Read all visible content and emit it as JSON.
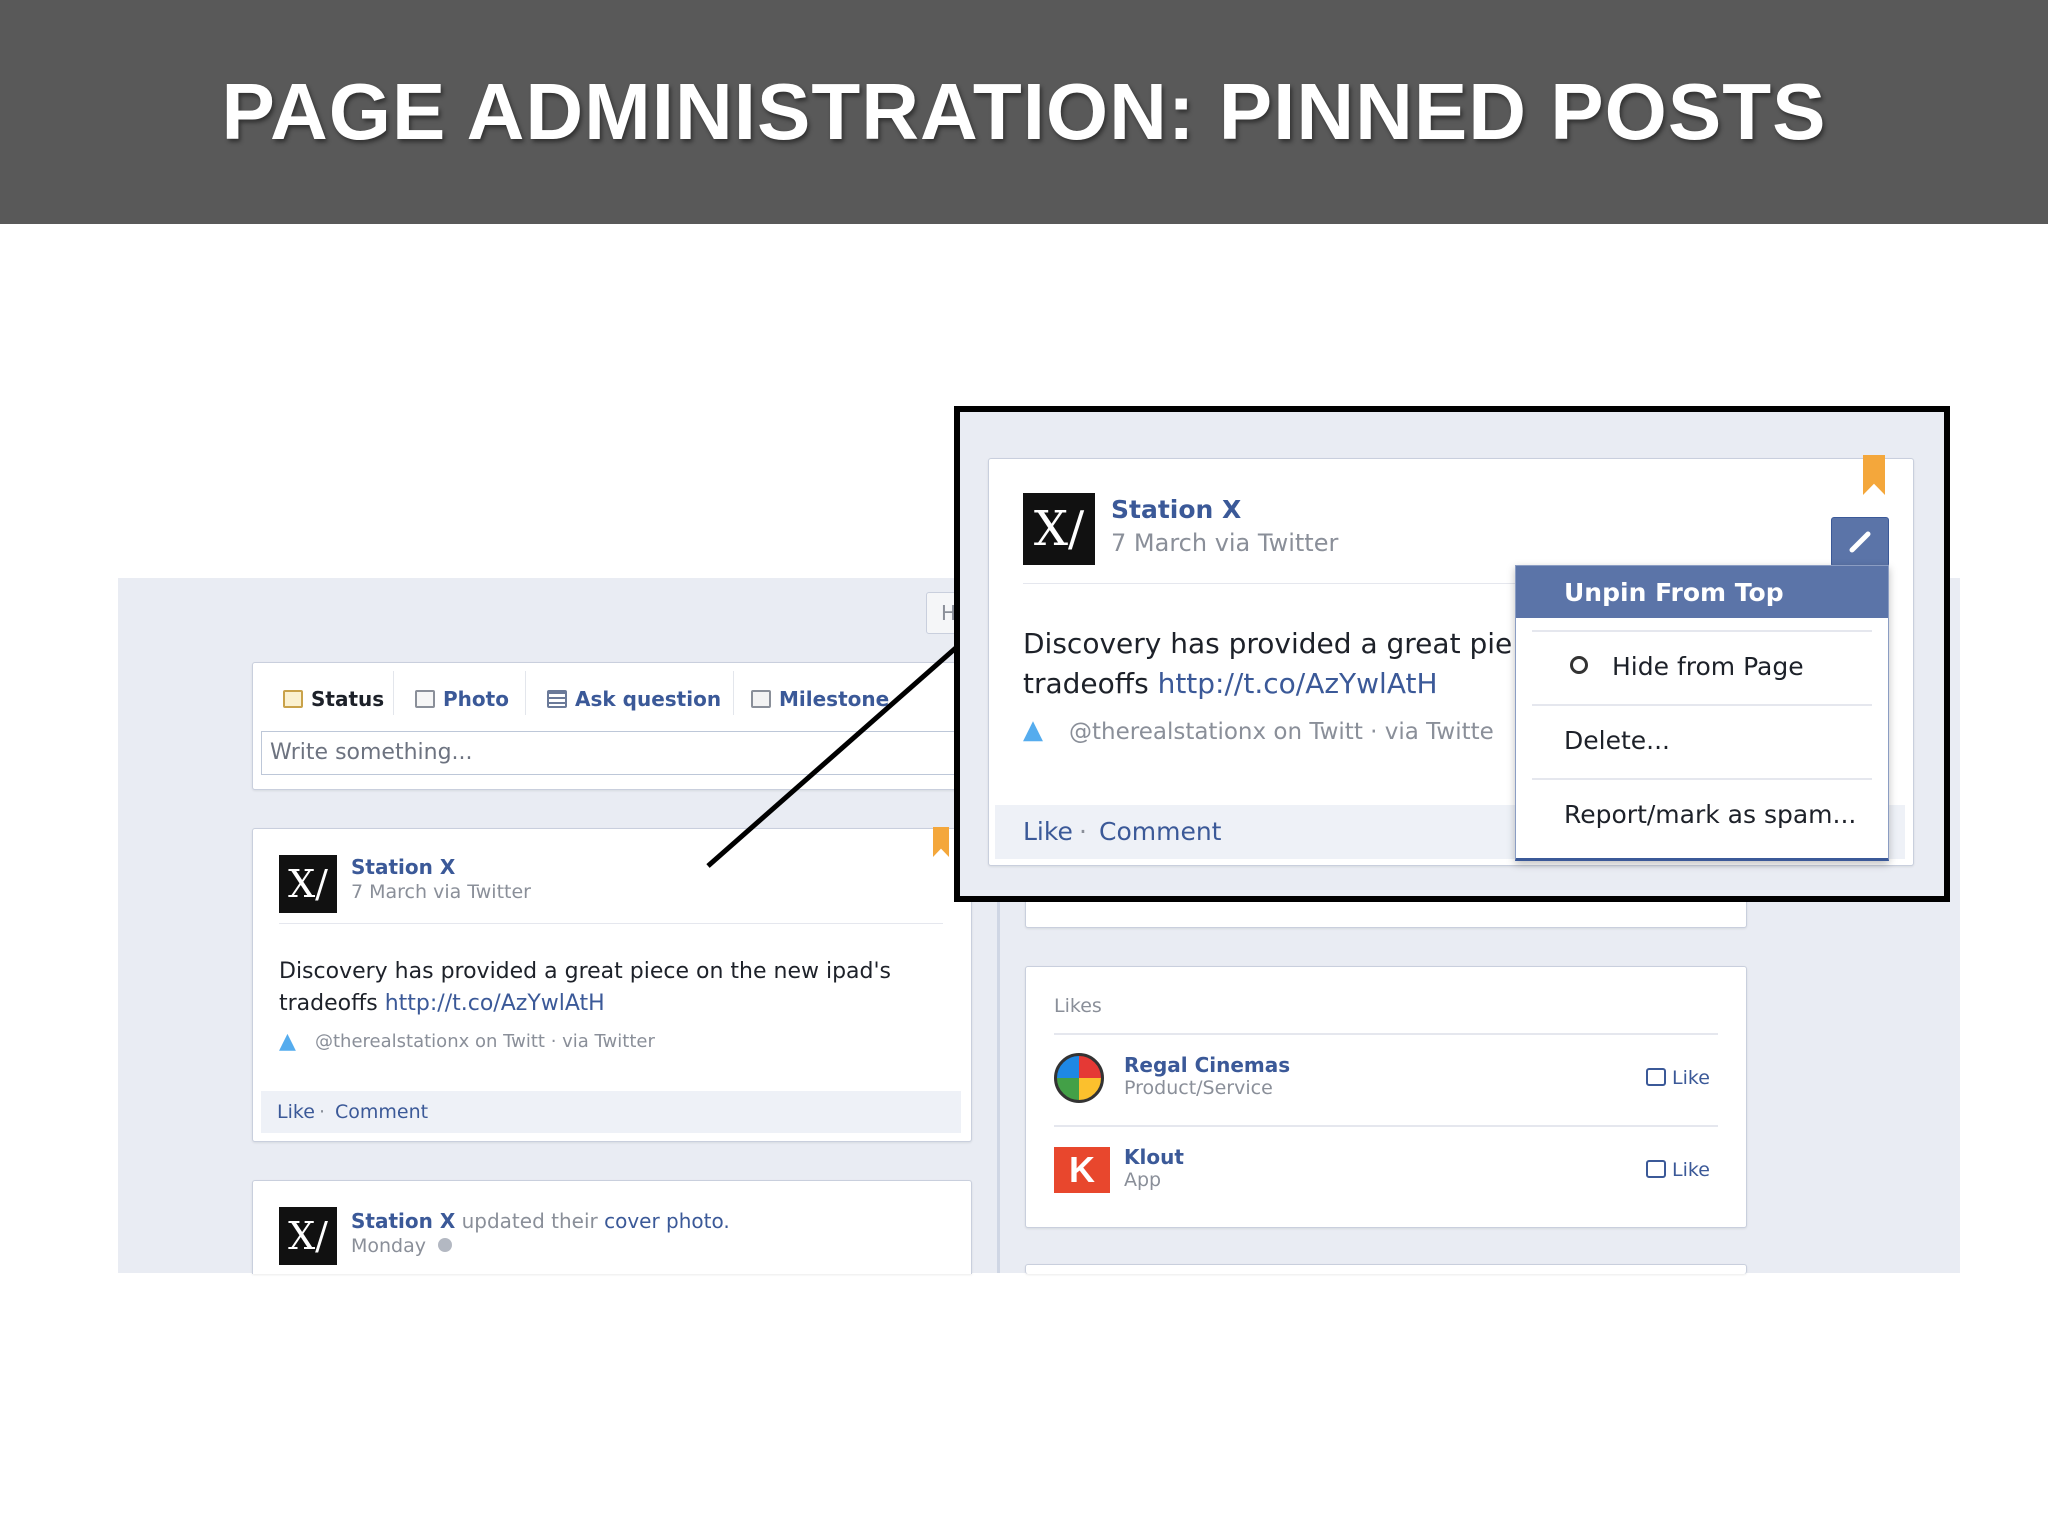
{
  "slide": {
    "title": "PAGE ADMINISTRATION: PINNED POSTS"
  },
  "composer": {
    "tabs": [
      {
        "label": "Status",
        "icon": "status-icon"
      },
      {
        "label": "Photo",
        "icon": "photo-icon"
      },
      {
        "label": "Ask question",
        "icon": "ask-question-icon"
      },
      {
        "label": "Milestone",
        "icon": "milestone-icon"
      }
    ],
    "placeholder": "Write something...",
    "partial_button": "H"
  },
  "post": {
    "author": "Station X",
    "meta": "7 March via Twitter",
    "body_text": "Discovery has provided a great piece on the new ipad's tradeoffs",
    "body_line1": "Discovery has provided a great piece on the new ipad's",
    "body_line2_prefix": "tradeoffs",
    "link": "http://t.co/AzYwlAtH",
    "source": "@therealstationx on Twitt · via Twitter",
    "like": "Like",
    "sep": "·",
    "comment": "Comment",
    "avatar_glyph": "X/"
  },
  "post2": {
    "author": "Station X",
    "action_mid": "updated their",
    "action_link": "cover photo.",
    "time": "Monday"
  },
  "likes": {
    "header": "Likes",
    "items": [
      {
        "name": "Regal Cinemas",
        "category": "Product/Service",
        "action": "Like"
      },
      {
        "name": "Klout",
        "category": "App",
        "action": "Like"
      }
    ]
  },
  "callout": {
    "author": "Station X",
    "meta": "7 March via Twitter",
    "body_line1": "Discovery has provided a great pie",
    "body_line2_prefix": "tradeoffs",
    "link": "http://t.co/AzYwlAtH",
    "source": "@therealstationx on Twitt · via Twitte",
    "like": "Like",
    "sep": "·",
    "comment": "Comment",
    "menu": {
      "items": [
        {
          "label": "Unpin From Top",
          "highlighted": true
        },
        {
          "label": "Hide from Page",
          "icon": "hide-circle-icon"
        },
        {
          "label": "Delete..."
        },
        {
          "label": "Report/mark as spam..."
        }
      ]
    }
  },
  "colors": {
    "title_bar": "#595959",
    "facebook_blue": "#3b5998",
    "menu_highlight": "#5b74a8",
    "pin_orange": "#f4a73b",
    "page_bg": "#e9ecf3"
  }
}
